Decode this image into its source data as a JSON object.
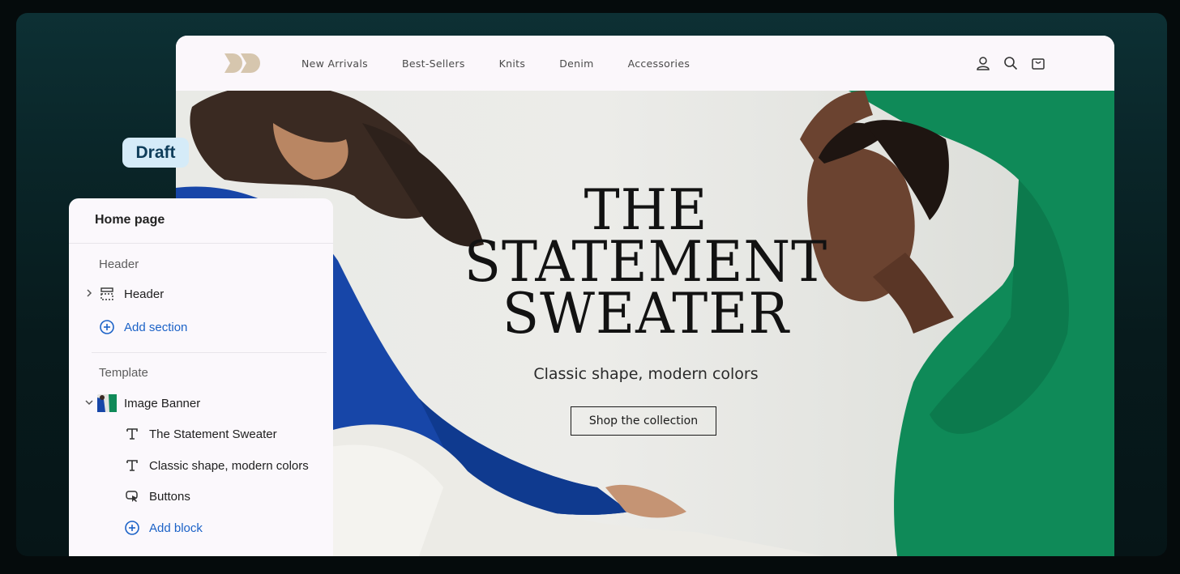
{
  "badge": {
    "label": "Draft"
  },
  "site": {
    "nav": [
      "New Arrivals",
      "Best-Sellers",
      "Knits",
      "Denim",
      "Accessories"
    ],
    "icons": [
      "account-icon",
      "search-icon",
      "cart-icon"
    ]
  },
  "hero": {
    "headline_lines": [
      "THE",
      "STATEMENT",
      "SWEATER"
    ],
    "subheading": "Classic shape, modern colors",
    "button_label": "Shop the collection"
  },
  "panel": {
    "title": "Home page",
    "header_group": {
      "label": "Header",
      "items": [
        {
          "label": "Header",
          "icon": "layout-header-icon"
        }
      ],
      "add_label": "Add section"
    },
    "template_group": {
      "label": "Template",
      "section": {
        "label": "Image Banner",
        "icon": "image-thumbnail"
      },
      "blocks": [
        {
          "label": "The Statement Sweater",
          "icon": "text-icon"
        },
        {
          "label": "Classic shape, modern colors",
          "icon": "text-icon"
        },
        {
          "label": "Buttons",
          "icon": "button-icon"
        }
      ],
      "add_label": "Add block"
    }
  },
  "colors": {
    "accent": "#1b62c7",
    "logo": "#d6c6ae",
    "sweater_blue": "#1746a8",
    "sweater_green": "#0f8a58"
  }
}
